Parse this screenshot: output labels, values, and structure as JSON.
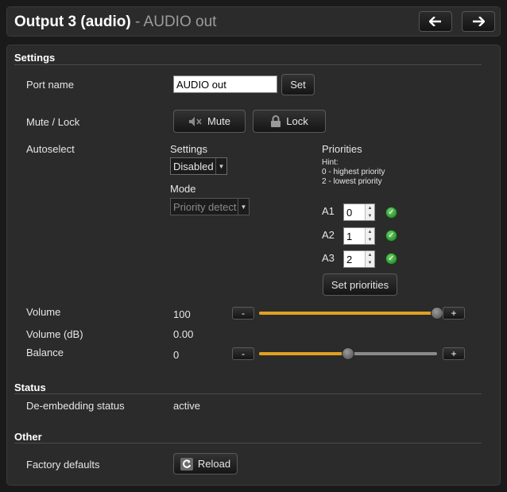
{
  "header": {
    "title_main": "Output 3 (audio)",
    "title_sep": " - ",
    "title_sub": "AUDIO out",
    "prev_icon": "arrow-left-icon",
    "next_icon": "arrow-right-icon"
  },
  "settings": {
    "section_title": "Settings",
    "port_name": {
      "label": "Port name",
      "value": "AUDIO out",
      "button": "Set"
    },
    "mute_lock": {
      "label": "Mute / Lock",
      "mute_label": "Mute",
      "lock_label": "Lock"
    },
    "autoselect": {
      "label": "Autoselect",
      "settings_label": "Settings",
      "settings_value": "Disabled",
      "mode_label": "Mode",
      "mode_value": "Priority detect",
      "priorities_label": "Priorities",
      "hint_title": "Hint:",
      "hint_line1": "0 - highest priority",
      "hint_line2": "2 - lowest priority",
      "priorities": [
        {
          "name": "A1",
          "value": "0"
        },
        {
          "name": "A2",
          "value": "1"
        },
        {
          "name": "A3",
          "value": "2"
        }
      ],
      "set_priorities_button": "Set priorities"
    },
    "volume": {
      "label": "Volume",
      "value": "100",
      "minus": "-",
      "plus": "+",
      "level_percent": 100
    },
    "volume_db": {
      "label": "Volume (dB)",
      "value": "0.00"
    },
    "balance": {
      "label": "Balance",
      "value": "0",
      "minus": "-",
      "plus": "+",
      "level_percent": 50
    }
  },
  "status": {
    "section_title": "Status",
    "deembedding": {
      "label": "De-embedding status",
      "value": "active"
    }
  },
  "other": {
    "section_title": "Other",
    "factory": {
      "label": "Factory defaults",
      "button": "Reload"
    }
  },
  "colors": {
    "accent": "#e0a020",
    "status_ok": "#2e9e2e",
    "background": "#2b2b2b"
  }
}
